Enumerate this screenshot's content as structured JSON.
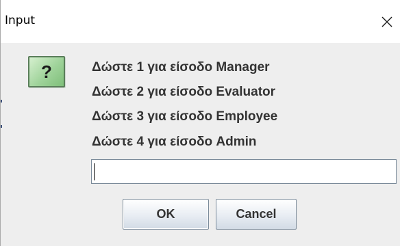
{
  "window": {
    "title": "Input",
    "close_glyph": "✕"
  },
  "icon": {
    "name": "question-icon",
    "glyph": "?",
    "colors": {
      "fill": "#9fd39a",
      "border": "#5a7d5a"
    }
  },
  "message": {
    "lines": [
      "Δώστε 1 για είσοδο Manager",
      "Δώστε 2 για είσοδο Evaluator",
      "Δώστε 3 για είσοδο Employee",
      "Δώστε 4 για είσοδο Admin"
    ]
  },
  "input": {
    "value": "",
    "placeholder": ""
  },
  "buttons": {
    "ok_label": "OK",
    "cancel_label": "Cancel"
  },
  "colors": {
    "dialog_background": "#eeeeee",
    "titlebar_background": "#ffffff",
    "text": "#333333"
  }
}
